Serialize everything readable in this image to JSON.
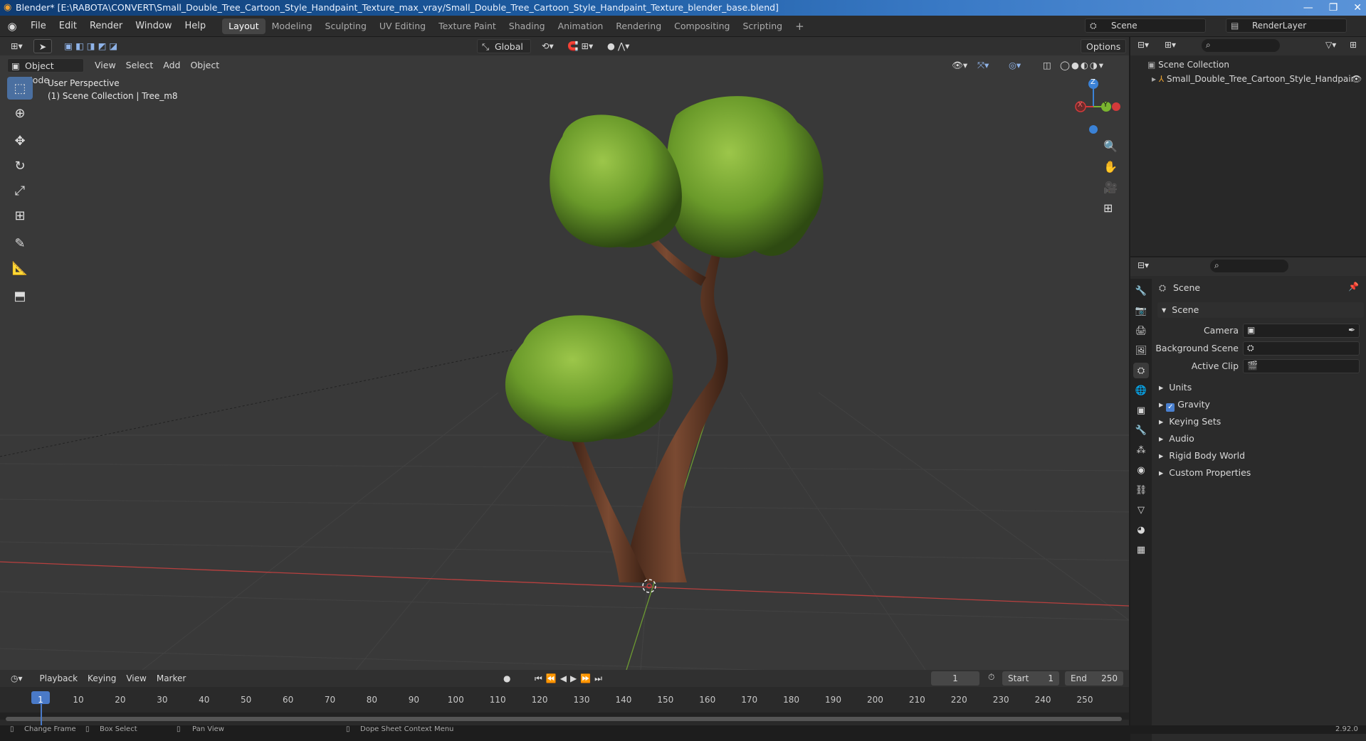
{
  "window": {
    "title": "Blender* [E:\\RABOTA\\CONVERT\\Small_Double_Tree_Cartoon_Style_Handpaint_Texture_max_vray/Small_Double_Tree_Cartoon_Style_Handpaint_Texture_blender_base.blend]"
  },
  "menus": [
    "File",
    "Edit",
    "Render",
    "Window",
    "Help"
  ],
  "workspaces": [
    "Layout",
    "Modeling",
    "Sculpting",
    "UV Editing",
    "Texture Paint",
    "Shading",
    "Animation",
    "Rendering",
    "Compositing",
    "Scripting"
  ],
  "active_workspace": "Layout",
  "scene_field": "Scene",
  "renderlayer_field": "RenderLayer",
  "viewport": {
    "mode": "Object Mode",
    "menus": [
      "View",
      "Select",
      "Add",
      "Object"
    ],
    "transform_orientation": "Global",
    "options": "Options",
    "overlay_line1": "User Perspective",
    "overlay_line2": "(1) Scene Collection | Tree_m8"
  },
  "gizmo": {
    "z": "Z",
    "y": "Y",
    "x": "X"
  },
  "outliner": {
    "root": "Scene Collection",
    "item": "Small_Double_Tree_Cartoon_Style_Handpair"
  },
  "properties": {
    "header": "Scene",
    "panel": "Scene",
    "camera_label": "Camera",
    "bg_scene_label": "Background Scene",
    "active_clip_label": "Active Clip",
    "sections": [
      "Units",
      "Gravity",
      "Keying Sets",
      "Audio",
      "Rigid Body World",
      "Custom Properties"
    ],
    "gravity_checked": true
  },
  "timeline": {
    "menus": [
      "Playback",
      "Keying",
      "View",
      "Marker"
    ],
    "current_frame": "1",
    "start_label": "Start",
    "start": "1",
    "end_label": "End",
    "end": "250",
    "ticks": [
      "1",
      "10",
      "20",
      "30",
      "40",
      "50",
      "60",
      "70",
      "80",
      "90",
      "100",
      "110",
      "120",
      "130",
      "140",
      "150",
      "160",
      "170",
      "180",
      "190",
      "200",
      "210",
      "220",
      "230",
      "240",
      "250"
    ]
  },
  "status": {
    "items": [
      "Change Frame",
      "Box Select",
      "Pan View",
      "Dope Sheet Context Menu"
    ],
    "version": "2.92.0"
  },
  "colors": {
    "accent": "#4a6fa0",
    "axis_x": "#d33a3a",
    "axis_y": "#7ab52f",
    "axis_z": "#3b82d6",
    "foliage": "#6a9a2a",
    "trunk": "#5a3422"
  }
}
